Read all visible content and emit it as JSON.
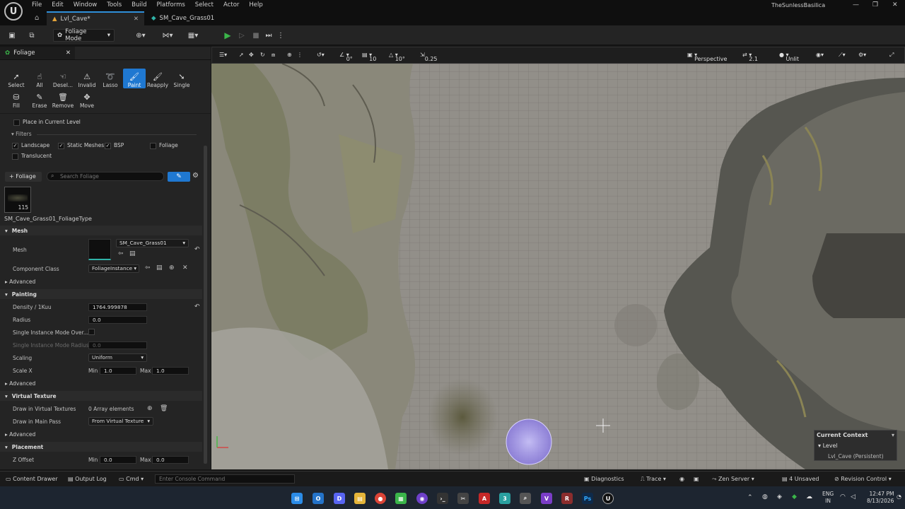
{
  "menu": [
    "File",
    "Edit",
    "Window",
    "Tools",
    "Build",
    "Platforms",
    "Select",
    "Actor",
    "Help"
  ],
  "project": "TheSunlessBasilica",
  "tabs": {
    "level": "Lvl_Cave*",
    "asset": "SM_Cave_Grass01"
  },
  "toolbar": {
    "mode": "Foliage Mode"
  },
  "panel": {
    "title": "Foliage",
    "tools": [
      "Select",
      "All",
      "Desel...",
      "Invalid",
      "Lasso",
      "Paint",
      "Reapply",
      "Single",
      "Fill",
      "Erase",
      "Remove",
      "Move"
    ],
    "place_in_level": "Place in Current Level",
    "filters_label": "Filters",
    "filters": {
      "landscape": "Landscape",
      "static_meshes": "Static Meshes",
      "bsp": "BSP",
      "foliage": "Foliage",
      "translucent": "Translucent"
    },
    "add_foliage": "+ Foliage",
    "search_placeholder": "Search Foliage",
    "thumb_count": "115",
    "foliage_type": "SM_Cave_Grass01_FoliageType"
  },
  "details": {
    "mesh_section": "Mesh",
    "mesh_label": "Mesh",
    "mesh_value": "SM_Cave_Grass01",
    "component_label": "Component Class",
    "component_value": "FoliageInstance",
    "advanced": "Advanced",
    "painting_section": "Painting",
    "density_label": "Density / 1Kuu",
    "density_value": "1764.999878",
    "radius_label": "Radius",
    "radius_value": "0.0",
    "single_mode_label": "Single Instance Mode Over...",
    "single_radius_label": "Single Instance Mode Radius",
    "single_radius_value": "0.0",
    "scaling_label": "Scaling",
    "scaling_value": "Uniform",
    "scalex_label": "Scale X",
    "min": "Min",
    "max": "Max",
    "scalex_min": "1.0",
    "scalex_max": "1.0",
    "vt_section": "Virtual Texture",
    "draw_vt_label": "Draw in Virtual Textures",
    "draw_vt_value": "0 Array elements",
    "draw_main_label": "Draw in Main Pass",
    "draw_main_value": "From Virtual Texture",
    "placement_section": "Placement",
    "zoffset_label": "Z Offset",
    "zoffset_min": "0.0",
    "zoffset_max": "0.0"
  },
  "viewport": {
    "rot": "0°",
    "grid": "10",
    "angle": "10°",
    "scale": "0.25",
    "perspective": "Perspective",
    "speed": "2.1",
    "lighting": "Unlit",
    "context_title": "Current Context",
    "context_level": "Level",
    "context_value": "Lvl_Cave (Persistent)"
  },
  "statusbar": {
    "content_drawer": "Content Drawer",
    "output_log": "Output Log",
    "cmd": "Cmd",
    "console_placeholder": "Enter Console Command",
    "diagnostics": "Diagnostics",
    "trace": "Trace",
    "zen": "Zen Server",
    "unsaved": "4 Unsaved",
    "revision": "Revision Control"
  },
  "taskbar": {
    "lang1": "ENG",
    "lang2": "IN",
    "time": "12:47 PM",
    "date": "8/13/2026"
  },
  "colors": {
    "accent": "#1f78d1",
    "play": "#3bb54a"
  }
}
